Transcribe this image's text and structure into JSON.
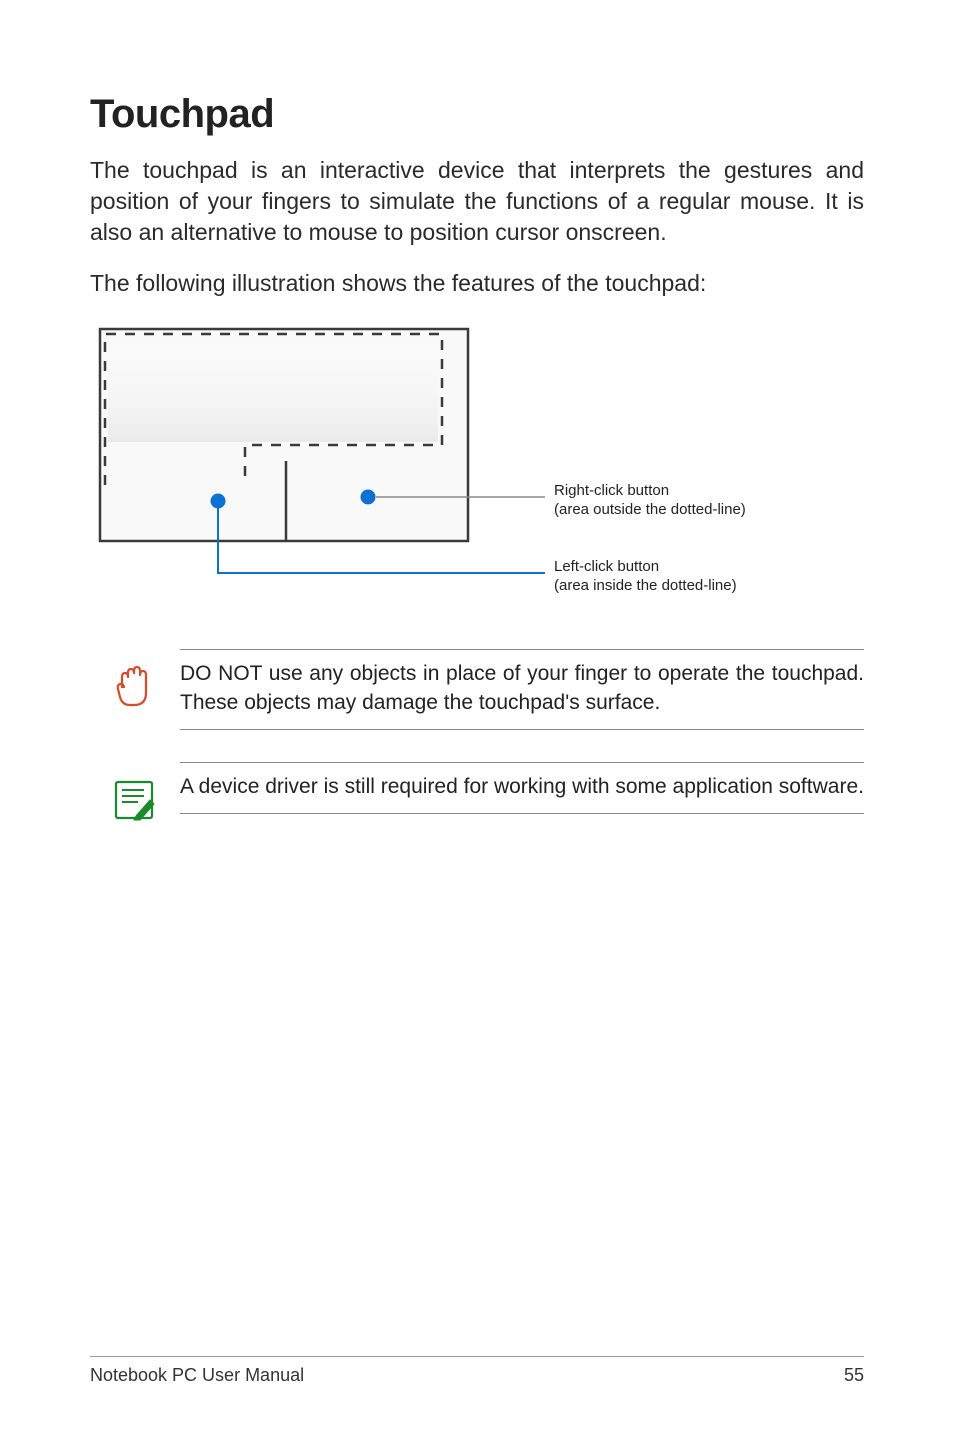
{
  "heading": "Touchpad",
  "intro_paragraph": "The touchpad is an interactive device that interprets the gestures and position of your fingers to simulate the functions of a regular mouse. It is also an alternative to mouse to position cursor onscreen.",
  "lead_sentence": "The following illustration shows the features of the touchpad:",
  "diagram": {
    "right_click_label": "Right-click button",
    "right_click_sub": "(area outside the dotted-line)",
    "left_click_label": "Left-click button",
    "left_click_sub": "(area inside the dotted-line)"
  },
  "warning_note": "DO NOT use any objects in place of your finger to operate the touchpad. These objects may damage the touchpad's surface.",
  "info_note": "A device driver is still required for working with some application software.",
  "footer_left": "Notebook PC User Manual",
  "footer_right": "55"
}
